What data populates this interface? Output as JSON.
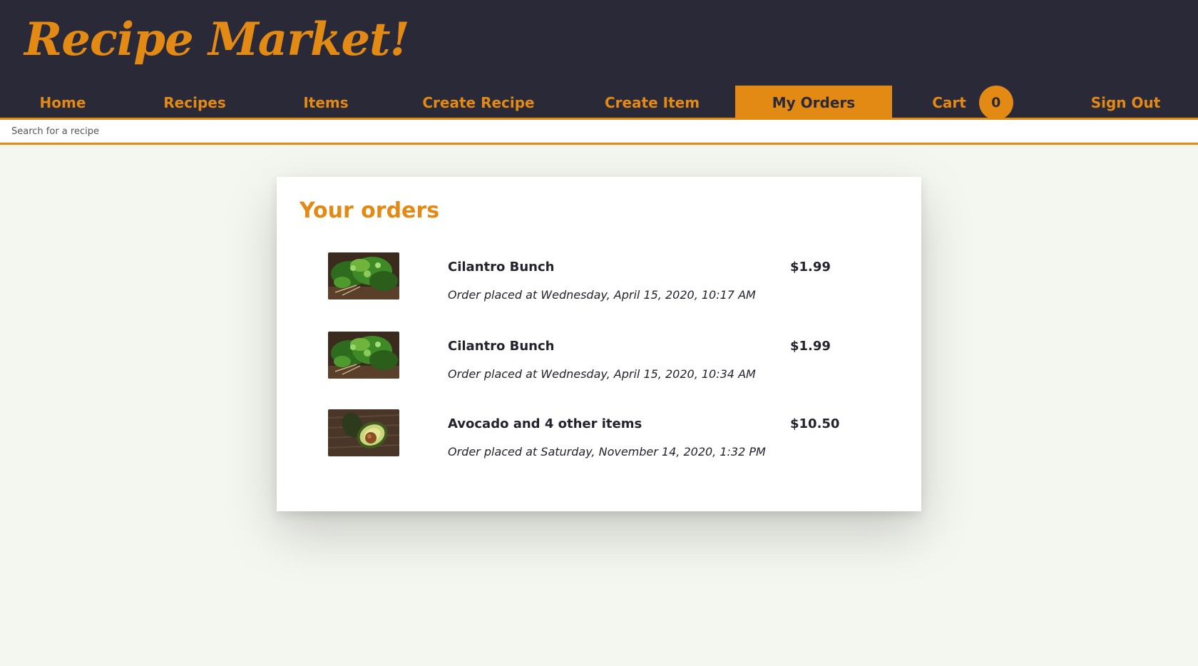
{
  "app": {
    "logo": "Recipe Market!"
  },
  "nav": {
    "items": [
      {
        "label": "Home"
      },
      {
        "label": "Recipes"
      },
      {
        "label": "Items"
      },
      {
        "label": "Create Recipe"
      },
      {
        "label": "Create Item"
      },
      {
        "label": "My Orders"
      },
      {
        "label": "Cart",
        "badge": "0"
      },
      {
        "label": "Sign Out"
      }
    ],
    "active": "My Orders"
  },
  "search": {
    "placeholder": "Search for a recipe"
  },
  "orders": {
    "title": "Your orders",
    "items": [
      {
        "name": "Cilantro Bunch",
        "date": "Order placed at Wednesday, April 15, 2020, 10:17 AM",
        "price": "$1.99",
        "image": "cilantro-image"
      },
      {
        "name": "Cilantro Bunch",
        "date": "Order placed at Wednesday, April 15, 2020, 10:34 AM",
        "price": "$1.99",
        "image": "cilantro-image"
      },
      {
        "name": "Avocado and 4 other items",
        "date": "Order placed at Saturday, November 14, 2020, 1:32 PM",
        "price": "$10.50",
        "image": "avocado-image"
      }
    ]
  },
  "colors": {
    "accent": "#e38a14",
    "header_bg": "#2a2937",
    "page_bg": "#f4f6f0",
    "card_bg": "#ffffff"
  }
}
